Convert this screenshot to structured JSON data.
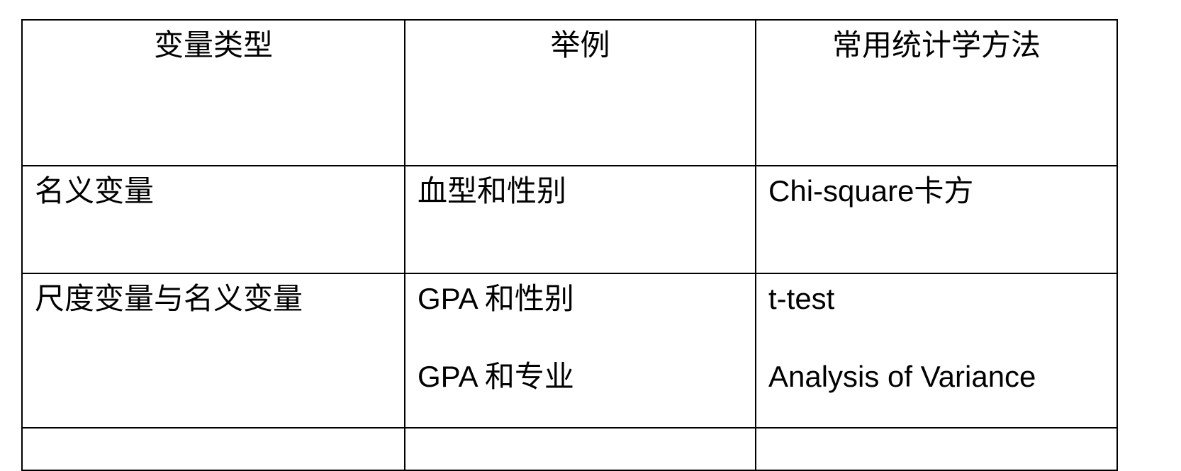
{
  "table": {
    "headers": [
      "变量类型",
      "举例",
      "常用统计学方法"
    ],
    "rows": [
      {
        "variable_type": "名义变量",
        "examples": [
          "血型和性别"
        ],
        "methods": [
          "Chi-square卡方"
        ]
      },
      {
        "variable_type": "尺度变量与名义变量",
        "examples": [
          "GPA 和性别",
          "GPA 和专业"
        ],
        "methods": [
          "t-test",
          "Analysis of Variance"
        ]
      },
      {
        "variable_type": "",
        "examples": [
          ""
        ],
        "methods": [
          ""
        ]
      }
    ]
  }
}
